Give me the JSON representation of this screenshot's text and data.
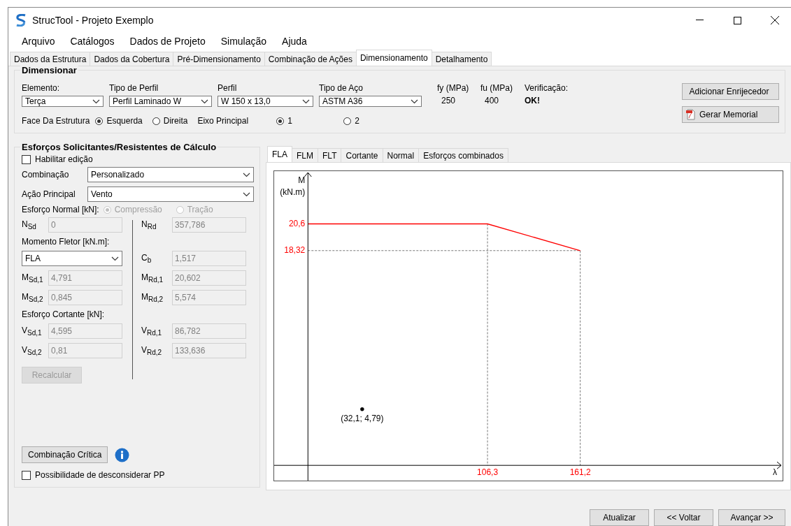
{
  "window": {
    "title": "StrucTool - Projeto Exemplo"
  },
  "menu": [
    "Arquivo",
    "Catálogos",
    "Dados de Projeto",
    "Simulação",
    "Ajuda"
  ],
  "tabs": [
    {
      "label": "Dados da Estrutura",
      "selected": false
    },
    {
      "label": "Dados da Cobertura",
      "selected": false
    },
    {
      "label": "Pré-Dimensionamento",
      "selected": false
    },
    {
      "label": "Combinação de Ações",
      "selected": false
    },
    {
      "label": "Dimensionamento",
      "selected": true
    },
    {
      "label": "Detalhamento",
      "selected": false
    }
  ],
  "dimensionar": {
    "title": "Dimensionar",
    "selects": [
      {
        "label": "Elemento:",
        "value": "Terça"
      },
      {
        "label": "Tipo de Perfil",
        "value": "Perfil Laminado W"
      },
      {
        "label": "Perfil",
        "value": "W 150 x 13,0"
      },
      {
        "label": "Tipo de Aço",
        "value": "ASTM A36"
      }
    ],
    "readouts": [
      {
        "label": "fy (MPa)",
        "value": "250",
        "kind": "plain"
      },
      {
        "label": "fu (MPa)",
        "value": "400",
        "kind": "plain"
      },
      {
        "label": "Verificação:",
        "value": "OK!",
        "kind": "bold"
      }
    ],
    "radio_groups": [
      {
        "label": "Face Da Estrutura",
        "options": [
          {
            "label": "Esquerda",
            "selected": true
          },
          {
            "label": "Direita",
            "selected": false
          }
        ]
      },
      {
        "label": "Eixo Principal",
        "options": [
          {
            "label": "1",
            "selected": true
          },
          {
            "label": "2",
            "selected": false
          }
        ]
      }
    ],
    "buttons": [
      {
        "label": "Adicionar Enrijecedor",
        "kind": "plain"
      },
      {
        "label": "Gerar Memorial",
        "kind": "pdf"
      }
    ]
  },
  "esforcos": {
    "title": "Esforços Solicitantes/Resistentes de Cálculo",
    "habilitar": {
      "label": "Habilitar edição",
      "checked": false
    },
    "combos": [
      {
        "label": "Combinação",
        "value": "Personalizado"
      },
      {
        "label": "Ação Principal",
        "value": "Vento"
      }
    ],
    "normal": {
      "label": "Esforço Normal [kN]:",
      "disabled": true,
      "options": [
        {
          "label": "Compressão",
          "selected": true
        },
        {
          "label": "Tração",
          "selected": false
        }
      ]
    },
    "rows": [
      {
        "left": {
          "kind": "field",
          "label": "N$_{Sd}$",
          "value": "0",
          "disabled": true
        },
        "right": {
          "kind": "field",
          "label": "N$_{Rd}$",
          "value": "357,786",
          "disabled": true
        }
      },
      {
        "left": {
          "kind": "heading",
          "label": "Momento Fletor [kN.m]:"
        }
      },
      {
        "left": {
          "kind": "select",
          "value": "FLA"
        },
        "right": {
          "kind": "field",
          "label": "C$_{b}$",
          "value": "1,517",
          "disabled": true
        }
      },
      {
        "left": {
          "kind": "field",
          "label": "M$_{Sd,1}$",
          "value": "4,791",
          "disabled": true
        },
        "right": {
          "kind": "field",
          "label": "M$_{Rd,1}$",
          "value": "20,602",
          "disabled": true
        }
      },
      {
        "left": {
          "kind": "field",
          "label": "M$_{Sd,2}$",
          "value": "0,845",
          "disabled": true
        },
        "right": {
          "kind": "field",
          "label": "M$_{Rd,2}$",
          "value": "5,574",
          "disabled": true
        }
      },
      {
        "left": {
          "kind": "heading",
          "label": "Esforço Cortante [kN]:"
        }
      },
      {
        "left": {
          "kind": "field",
          "label": "V$_{Sd,1}$",
          "value": "4,595",
          "disabled": true
        },
        "right": {
          "kind": "field",
          "label": "V$_{Rd,1}$",
          "value": "86,782",
          "disabled": true
        }
      },
      {
        "left": {
          "kind": "field",
          "label": "V$_{Sd,2}$",
          "value": "0,81",
          "disabled": true
        },
        "right": {
          "kind": "field",
          "label": "V$_{Rd,2}$",
          "value": "133,636",
          "disabled": true
        }
      }
    ],
    "recalcular": {
      "label": "Recalcular",
      "disabled": true
    },
    "critica": {
      "label": "Combinação Crítica"
    },
    "pp": {
      "label": "Possibilidade de desconsiderar PP",
      "checked": false
    }
  },
  "chart_tabs": [
    {
      "label": "FLA",
      "selected": true
    },
    {
      "label": "FLM",
      "selected": false
    },
    {
      "label": "FLT",
      "selected": false
    },
    {
      "label": "Cortante",
      "selected": false
    },
    {
      "label": "Normal",
      "selected": false
    },
    {
      "label": "Esforços combinados",
      "selected": false
    }
  ],
  "chart_data": {
    "type": "line",
    "xlabel": "λ",
    "ylabel": "M (kN.m)",
    "x": [
      0,
      32.1,
      106.3,
      161.2
    ],
    "series": [
      {
        "color": "#ff0000",
        "values": [
          20.6,
          20.6,
          20.6,
          18.32
        ]
      },
      {
        "color": "#000000",
        "marker": "circle",
        "values": [
          null,
          4.79,
          null,
          null
        ]
      }
    ],
    "ref_lines": [
      {
        "axis": "x",
        "value": 106.3
      },
      {
        "axis": "x",
        "value": 161.2
      },
      {
        "axis": "y",
        "value": 18.32
      }
    ],
    "xlim": [
      -20,
      281
    ],
    "ylim": [
      -1.3,
      25.1
    ],
    "xticks": [
      {
        "value": 106.3,
        "label": "106,3"
      },
      {
        "value": 161.2,
        "label": "161,2"
      }
    ],
    "yticks": [
      {
        "value": 20.6,
        "label": "20,6"
      },
      {
        "value": 18.32,
        "label": "18,32"
      }
    ],
    "annotations": [
      "(32,1; 4,79)"
    ]
  },
  "footer_buttons": [
    "Atualizar",
    "<< Voltar",
    "Avançar >>"
  ]
}
